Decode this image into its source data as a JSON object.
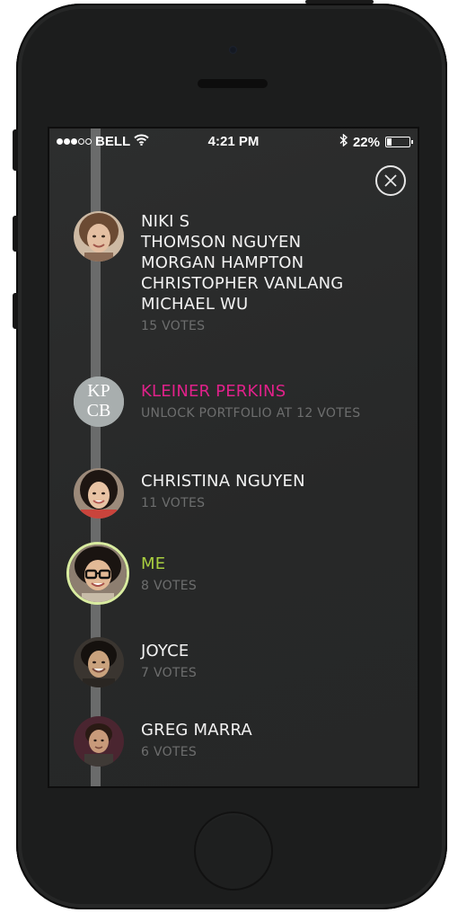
{
  "statusbar": {
    "carrier": "BELL",
    "time": "4:21 PM",
    "battery_percent": "22%",
    "battery_level": 0.22,
    "signal_bars_filled": 3,
    "signal_bars_total": 5
  },
  "icons": {
    "wifi": "wifi-icon",
    "bluetooth": "bluetooth-icon",
    "battery": "battery-icon",
    "close": "close-icon"
  },
  "colors": {
    "sponsor_name": "#e0218a",
    "current_user_name": "#a9cf3f",
    "current_user_ring": "#d9eca0",
    "timeline": "#6a6b6b",
    "muted_text": "#6d6e6e"
  },
  "leaderboard": [
    {
      "names": [
        "NIKI S",
        "THOMSON NGUYEN",
        "MORGAN HAMPTON",
        "CHRISTOPHER VANLANG",
        "MICHAEL WU"
      ],
      "votes": "15 VOTES"
    },
    {
      "names": [
        "KLEINER PERKINS"
      ],
      "votes": "UNLOCK PORTFOLIO AT 12 VOTES",
      "avatar_text": "KP CB"
    },
    {
      "names": [
        "CHRISTINA NGUYEN"
      ],
      "votes": "11 VOTES"
    },
    {
      "names": [
        "ME"
      ],
      "votes": "8 VOTES"
    },
    {
      "names": [
        "JOYCE"
      ],
      "votes": "7 VOTES"
    },
    {
      "names": [
        "GREG MARRA"
      ],
      "votes": "6 VOTES"
    }
  ]
}
